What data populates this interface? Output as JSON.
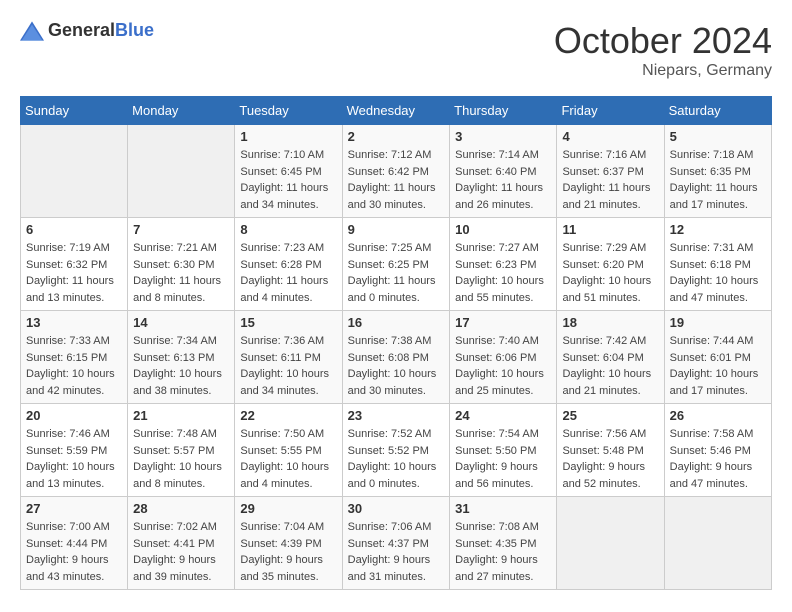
{
  "header": {
    "logo_general": "General",
    "logo_blue": "Blue",
    "month": "October 2024",
    "location": "Niepars, Germany"
  },
  "weekdays": [
    "Sunday",
    "Monday",
    "Tuesday",
    "Wednesday",
    "Thursday",
    "Friday",
    "Saturday"
  ],
  "weeks": [
    [
      {
        "day": "",
        "sunrise": "",
        "sunset": "",
        "daylight": "",
        "empty": true
      },
      {
        "day": "",
        "sunrise": "",
        "sunset": "",
        "daylight": "",
        "empty": true
      },
      {
        "day": "1",
        "sunrise": "Sunrise: 7:10 AM",
        "sunset": "Sunset: 6:45 PM",
        "daylight": "Daylight: 11 hours and 34 minutes."
      },
      {
        "day": "2",
        "sunrise": "Sunrise: 7:12 AM",
        "sunset": "Sunset: 6:42 PM",
        "daylight": "Daylight: 11 hours and 30 minutes."
      },
      {
        "day": "3",
        "sunrise": "Sunrise: 7:14 AM",
        "sunset": "Sunset: 6:40 PM",
        "daylight": "Daylight: 11 hours and 26 minutes."
      },
      {
        "day": "4",
        "sunrise": "Sunrise: 7:16 AM",
        "sunset": "Sunset: 6:37 PM",
        "daylight": "Daylight: 11 hours and 21 minutes."
      },
      {
        "day": "5",
        "sunrise": "Sunrise: 7:18 AM",
        "sunset": "Sunset: 6:35 PM",
        "daylight": "Daylight: 11 hours and 17 minutes."
      }
    ],
    [
      {
        "day": "6",
        "sunrise": "Sunrise: 7:19 AM",
        "sunset": "Sunset: 6:32 PM",
        "daylight": "Daylight: 11 hours and 13 minutes."
      },
      {
        "day": "7",
        "sunrise": "Sunrise: 7:21 AM",
        "sunset": "Sunset: 6:30 PM",
        "daylight": "Daylight: 11 hours and 8 minutes."
      },
      {
        "day": "8",
        "sunrise": "Sunrise: 7:23 AM",
        "sunset": "Sunset: 6:28 PM",
        "daylight": "Daylight: 11 hours and 4 minutes."
      },
      {
        "day": "9",
        "sunrise": "Sunrise: 7:25 AM",
        "sunset": "Sunset: 6:25 PM",
        "daylight": "Daylight: 11 hours and 0 minutes."
      },
      {
        "day": "10",
        "sunrise": "Sunrise: 7:27 AM",
        "sunset": "Sunset: 6:23 PM",
        "daylight": "Daylight: 10 hours and 55 minutes."
      },
      {
        "day": "11",
        "sunrise": "Sunrise: 7:29 AM",
        "sunset": "Sunset: 6:20 PM",
        "daylight": "Daylight: 10 hours and 51 minutes."
      },
      {
        "day": "12",
        "sunrise": "Sunrise: 7:31 AM",
        "sunset": "Sunset: 6:18 PM",
        "daylight": "Daylight: 10 hours and 47 minutes."
      }
    ],
    [
      {
        "day": "13",
        "sunrise": "Sunrise: 7:33 AM",
        "sunset": "Sunset: 6:15 PM",
        "daylight": "Daylight: 10 hours and 42 minutes."
      },
      {
        "day": "14",
        "sunrise": "Sunrise: 7:34 AM",
        "sunset": "Sunset: 6:13 PM",
        "daylight": "Daylight: 10 hours and 38 minutes."
      },
      {
        "day": "15",
        "sunrise": "Sunrise: 7:36 AM",
        "sunset": "Sunset: 6:11 PM",
        "daylight": "Daylight: 10 hours and 34 minutes."
      },
      {
        "day": "16",
        "sunrise": "Sunrise: 7:38 AM",
        "sunset": "Sunset: 6:08 PM",
        "daylight": "Daylight: 10 hours and 30 minutes."
      },
      {
        "day": "17",
        "sunrise": "Sunrise: 7:40 AM",
        "sunset": "Sunset: 6:06 PM",
        "daylight": "Daylight: 10 hours and 25 minutes."
      },
      {
        "day": "18",
        "sunrise": "Sunrise: 7:42 AM",
        "sunset": "Sunset: 6:04 PM",
        "daylight": "Daylight: 10 hours and 21 minutes."
      },
      {
        "day": "19",
        "sunrise": "Sunrise: 7:44 AM",
        "sunset": "Sunset: 6:01 PM",
        "daylight": "Daylight: 10 hours and 17 minutes."
      }
    ],
    [
      {
        "day": "20",
        "sunrise": "Sunrise: 7:46 AM",
        "sunset": "Sunset: 5:59 PM",
        "daylight": "Daylight: 10 hours and 13 minutes."
      },
      {
        "day": "21",
        "sunrise": "Sunrise: 7:48 AM",
        "sunset": "Sunset: 5:57 PM",
        "daylight": "Daylight: 10 hours and 8 minutes."
      },
      {
        "day": "22",
        "sunrise": "Sunrise: 7:50 AM",
        "sunset": "Sunset: 5:55 PM",
        "daylight": "Daylight: 10 hours and 4 minutes."
      },
      {
        "day": "23",
        "sunrise": "Sunrise: 7:52 AM",
        "sunset": "Sunset: 5:52 PM",
        "daylight": "Daylight: 10 hours and 0 minutes."
      },
      {
        "day": "24",
        "sunrise": "Sunrise: 7:54 AM",
        "sunset": "Sunset: 5:50 PM",
        "daylight": "Daylight: 9 hours and 56 minutes."
      },
      {
        "day": "25",
        "sunrise": "Sunrise: 7:56 AM",
        "sunset": "Sunset: 5:48 PM",
        "daylight": "Daylight: 9 hours and 52 minutes."
      },
      {
        "day": "26",
        "sunrise": "Sunrise: 7:58 AM",
        "sunset": "Sunset: 5:46 PM",
        "daylight": "Daylight: 9 hours and 47 minutes."
      }
    ],
    [
      {
        "day": "27",
        "sunrise": "Sunrise: 7:00 AM",
        "sunset": "Sunset: 4:44 PM",
        "daylight": "Daylight: 9 hours and 43 minutes."
      },
      {
        "day": "28",
        "sunrise": "Sunrise: 7:02 AM",
        "sunset": "Sunset: 4:41 PM",
        "daylight": "Daylight: 9 hours and 39 minutes."
      },
      {
        "day": "29",
        "sunrise": "Sunrise: 7:04 AM",
        "sunset": "Sunset: 4:39 PM",
        "daylight": "Daylight: 9 hours and 35 minutes."
      },
      {
        "day": "30",
        "sunrise": "Sunrise: 7:06 AM",
        "sunset": "Sunset: 4:37 PM",
        "daylight": "Daylight: 9 hours and 31 minutes."
      },
      {
        "day": "31",
        "sunrise": "Sunrise: 7:08 AM",
        "sunset": "Sunset: 4:35 PM",
        "daylight": "Daylight: 9 hours and 27 minutes."
      },
      {
        "day": "",
        "sunrise": "",
        "sunset": "",
        "daylight": "",
        "empty": true
      },
      {
        "day": "",
        "sunrise": "",
        "sunset": "",
        "daylight": "",
        "empty": true
      }
    ]
  ]
}
